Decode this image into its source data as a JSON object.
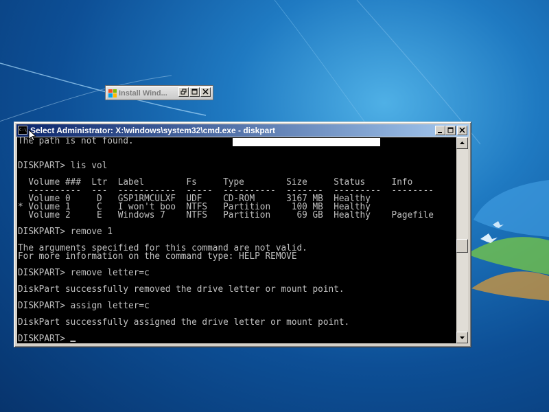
{
  "colors": {
    "desktop_accent": "#1f7ac2",
    "title_gradient_start": "#0a246a",
    "title_gradient_end": "#a6caf0",
    "console_background": "#000000",
    "console_text": "#c0c0c0",
    "window_face": "#d4d0c8"
  },
  "taskbar_window": {
    "title": "Install Wind...",
    "icon": "windows-flag-icon"
  },
  "cmd_window": {
    "title": "Select Administrator: X:\\windows\\system32\\cmd.exe - diskpart",
    "icon": "console-icon",
    "icon_glyph": "C:\\",
    "buttons": {
      "minimize": "minimize-icon",
      "maximize": "maximize-icon",
      "close": "close-icon"
    },
    "console_lines": [
      "The path is not found.",
      "",
      "",
      "DISKPART> lis vol",
      "",
      "  Volume ###  Ltr  Label        Fs     Type        Size     Status     Info",
      "  ----------  ---  -----------  -----  ----------  -------  ---------  --------",
      "  Volume 0     D   GSP1RMCULXF  UDF    CD-ROM      3167 MB  Healthy",
      "* Volume 1     C   I won't boo  NTFS   Partition    100 MB  Healthy",
      "  Volume 2     E   Windows 7    NTFS   Partition     69 GB  Healthy    Pagefile",
      "",
      "DISKPART> remove 1",
      "",
      "The arguments specified for this command are not valid.",
      "For more information on the command type: HELP REMOVE",
      "",
      "DISKPART> remove letter=c",
      "",
      "DiskPart successfully removed the drive letter or mount point.",
      "",
      "DISKPART> assign letter=c",
      "",
      "DiskPart successfully assigned the drive letter or mount point.",
      "",
      "DISKPART> "
    ]
  }
}
